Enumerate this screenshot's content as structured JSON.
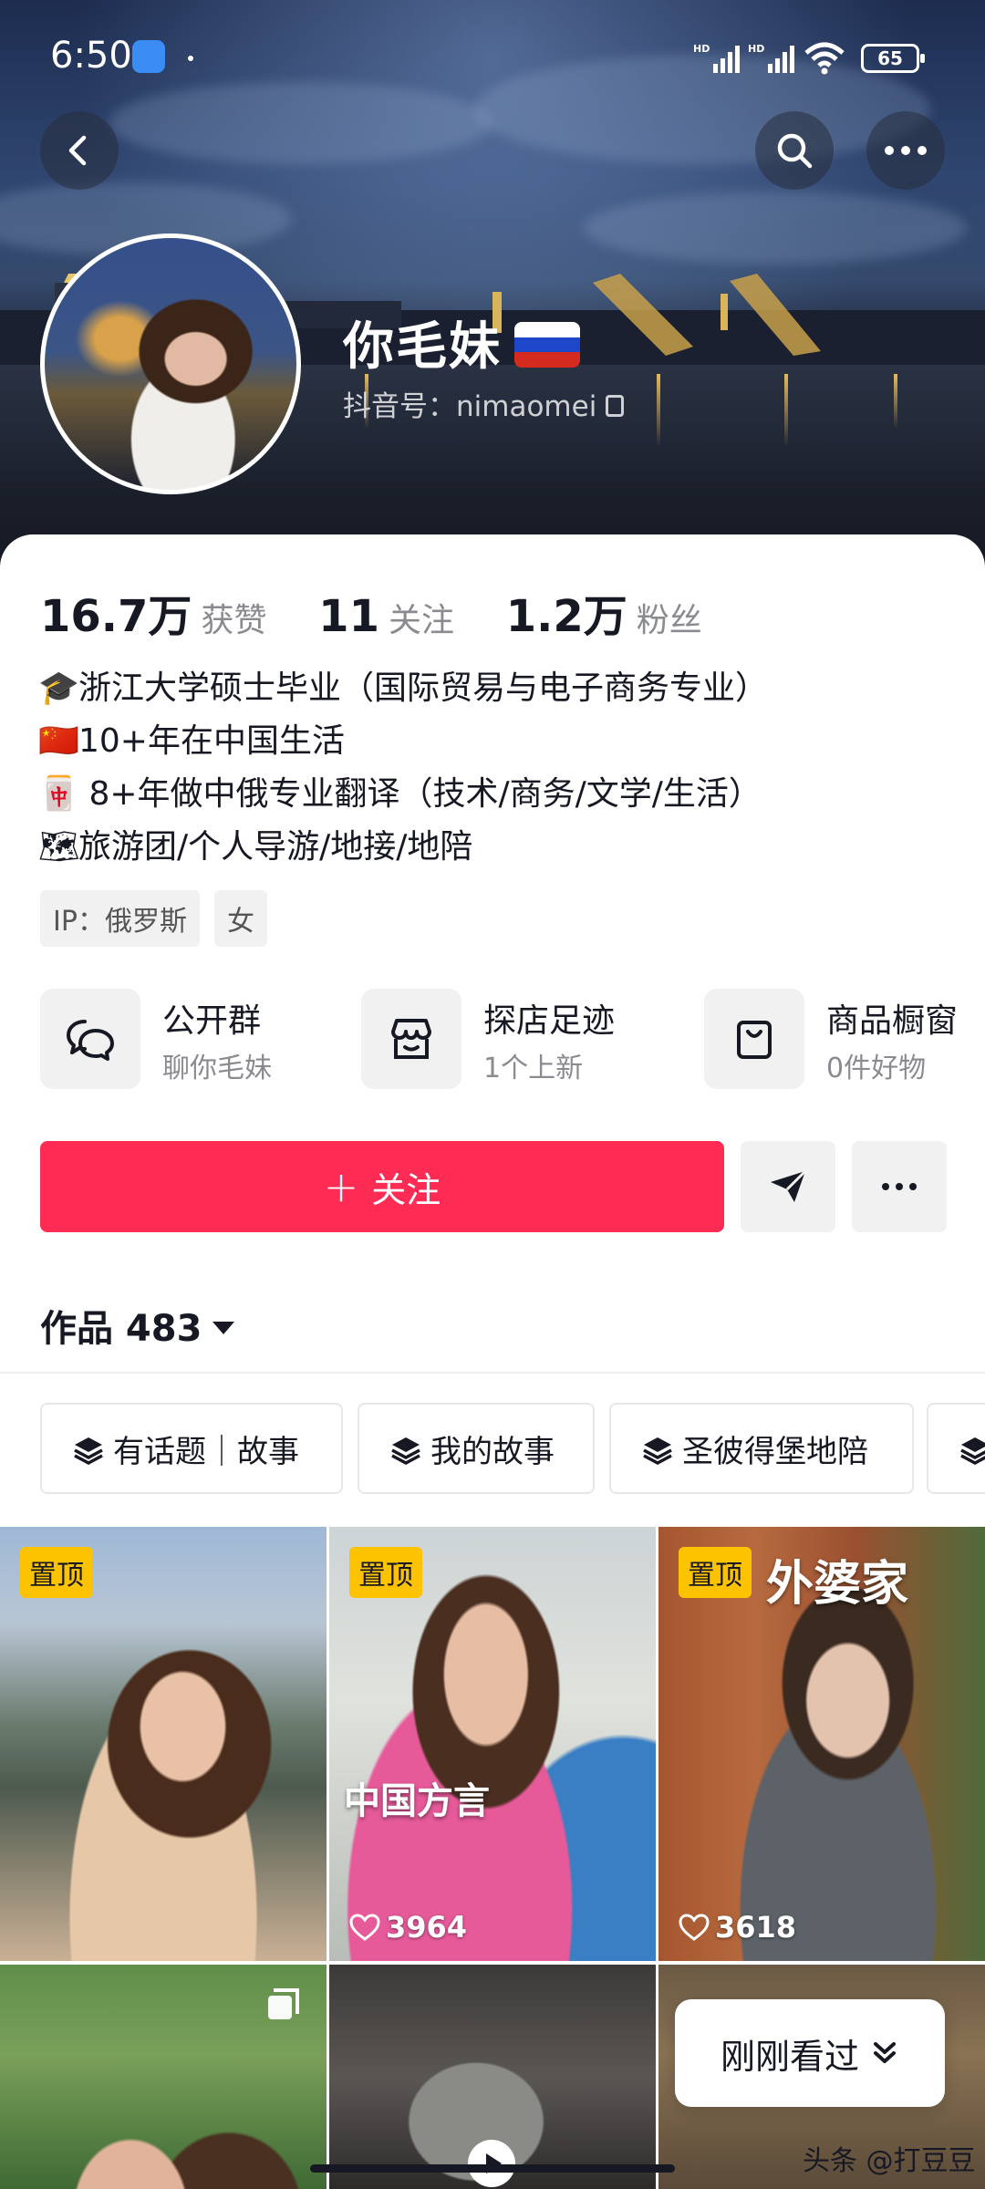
{
  "status_bar": {
    "time": "6:50",
    "battery": "65"
  },
  "profile": {
    "nickname": "你毛妹",
    "douyin_id": "抖音号：nimaomei"
  },
  "stats": [
    {
      "value": "16.7万",
      "label": "获赞"
    },
    {
      "value": "11",
      "label": "关注"
    },
    {
      "value": "1.2万",
      "label": "粉丝"
    }
  ],
  "bio": [
    {
      "emoji": "🎓",
      "text": "浙江大学硕士毕业（国际贸易与电子商务专业）"
    },
    {
      "emoji": "🇨🇳",
      "text": "10+年在中国生活"
    },
    {
      "emoji": "🀄",
      "text": " 8+年做中俄专业翻译（技术/商务/文学/生活）"
    },
    {
      "emoji": "🗺",
      "text": "旅游团/个人导游/地接/地陪"
    }
  ],
  "tags": [
    "IP：俄罗斯",
    "女"
  ],
  "shortcuts": [
    {
      "title": "公开群",
      "subtitle": "聊你毛妹",
      "icon": "chat-bubbles-icon"
    },
    {
      "title": "探店足迹",
      "subtitle": "1个上新",
      "icon": "shop-icon"
    },
    {
      "title": "商品橱窗",
      "subtitle": "0件好物",
      "icon": "shopping-bag-icon"
    }
  ],
  "actions": {
    "follow_label": "关注"
  },
  "works": {
    "label": "作品 483"
  },
  "collections": [
    "有话题｜故事",
    "我的故事",
    "圣彼得堡地陪"
  ],
  "videos": [
    {
      "pinned_label": "置顶",
      "likes": ""
    },
    {
      "pinned_label": "置顶",
      "likes": "3964",
      "title": "中国方言"
    },
    {
      "pinned_label": "置顶",
      "likes": "3618",
      "title": "外婆家"
    }
  ],
  "recent_button": {
    "label": "刚刚看过"
  },
  "watermark": "头条 @打豆豆"
}
